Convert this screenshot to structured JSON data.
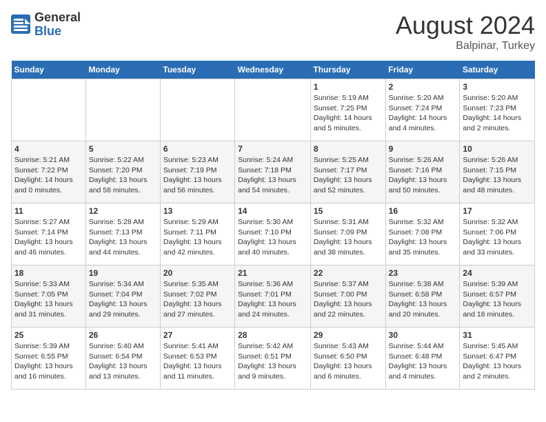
{
  "header": {
    "logo_general": "General",
    "logo_blue": "Blue",
    "month_year": "August 2024",
    "location": "Balpinar, Turkey"
  },
  "weekdays": [
    "Sunday",
    "Monday",
    "Tuesday",
    "Wednesday",
    "Thursday",
    "Friday",
    "Saturday"
  ],
  "weeks": [
    [
      {
        "day": "",
        "info": ""
      },
      {
        "day": "",
        "info": ""
      },
      {
        "day": "",
        "info": ""
      },
      {
        "day": "",
        "info": ""
      },
      {
        "day": "1",
        "info": "Sunrise: 5:19 AM\nSunset: 7:25 PM\nDaylight: 14 hours\nand 5 minutes."
      },
      {
        "day": "2",
        "info": "Sunrise: 5:20 AM\nSunset: 7:24 PM\nDaylight: 14 hours\nand 4 minutes."
      },
      {
        "day": "3",
        "info": "Sunrise: 5:20 AM\nSunset: 7:23 PM\nDaylight: 14 hours\nand 2 minutes."
      }
    ],
    [
      {
        "day": "4",
        "info": "Sunrise: 5:21 AM\nSunset: 7:22 PM\nDaylight: 14 hours\nand 0 minutes."
      },
      {
        "day": "5",
        "info": "Sunrise: 5:22 AM\nSunset: 7:20 PM\nDaylight: 13 hours\nand 58 minutes."
      },
      {
        "day": "6",
        "info": "Sunrise: 5:23 AM\nSunset: 7:19 PM\nDaylight: 13 hours\nand 56 minutes."
      },
      {
        "day": "7",
        "info": "Sunrise: 5:24 AM\nSunset: 7:18 PM\nDaylight: 13 hours\nand 54 minutes."
      },
      {
        "day": "8",
        "info": "Sunrise: 5:25 AM\nSunset: 7:17 PM\nDaylight: 13 hours\nand 52 minutes."
      },
      {
        "day": "9",
        "info": "Sunrise: 5:26 AM\nSunset: 7:16 PM\nDaylight: 13 hours\nand 50 minutes."
      },
      {
        "day": "10",
        "info": "Sunrise: 5:26 AM\nSunset: 7:15 PM\nDaylight: 13 hours\nand 48 minutes."
      }
    ],
    [
      {
        "day": "11",
        "info": "Sunrise: 5:27 AM\nSunset: 7:14 PM\nDaylight: 13 hours\nand 46 minutes."
      },
      {
        "day": "12",
        "info": "Sunrise: 5:28 AM\nSunset: 7:13 PM\nDaylight: 13 hours\nand 44 minutes."
      },
      {
        "day": "13",
        "info": "Sunrise: 5:29 AM\nSunset: 7:11 PM\nDaylight: 13 hours\nand 42 minutes."
      },
      {
        "day": "14",
        "info": "Sunrise: 5:30 AM\nSunset: 7:10 PM\nDaylight: 13 hours\nand 40 minutes."
      },
      {
        "day": "15",
        "info": "Sunrise: 5:31 AM\nSunset: 7:09 PM\nDaylight: 13 hours\nand 38 minutes."
      },
      {
        "day": "16",
        "info": "Sunrise: 5:32 AM\nSunset: 7:08 PM\nDaylight: 13 hours\nand 35 minutes."
      },
      {
        "day": "17",
        "info": "Sunrise: 5:32 AM\nSunset: 7:06 PM\nDaylight: 13 hours\nand 33 minutes."
      }
    ],
    [
      {
        "day": "18",
        "info": "Sunrise: 5:33 AM\nSunset: 7:05 PM\nDaylight: 13 hours\nand 31 minutes."
      },
      {
        "day": "19",
        "info": "Sunrise: 5:34 AM\nSunset: 7:04 PM\nDaylight: 13 hours\nand 29 minutes."
      },
      {
        "day": "20",
        "info": "Sunrise: 5:35 AM\nSunset: 7:02 PM\nDaylight: 13 hours\nand 27 minutes."
      },
      {
        "day": "21",
        "info": "Sunrise: 5:36 AM\nSunset: 7:01 PM\nDaylight: 13 hours\nand 24 minutes."
      },
      {
        "day": "22",
        "info": "Sunrise: 5:37 AM\nSunset: 7:00 PM\nDaylight: 13 hours\nand 22 minutes."
      },
      {
        "day": "23",
        "info": "Sunrise: 5:38 AM\nSunset: 6:58 PM\nDaylight: 13 hours\nand 20 minutes."
      },
      {
        "day": "24",
        "info": "Sunrise: 5:39 AM\nSunset: 6:57 PM\nDaylight: 13 hours\nand 18 minutes."
      }
    ],
    [
      {
        "day": "25",
        "info": "Sunrise: 5:39 AM\nSunset: 6:55 PM\nDaylight: 13 hours\nand 16 minutes."
      },
      {
        "day": "26",
        "info": "Sunrise: 5:40 AM\nSunset: 6:54 PM\nDaylight: 13 hours\nand 13 minutes."
      },
      {
        "day": "27",
        "info": "Sunrise: 5:41 AM\nSunset: 6:53 PM\nDaylight: 13 hours\nand 11 minutes."
      },
      {
        "day": "28",
        "info": "Sunrise: 5:42 AM\nSunset: 6:51 PM\nDaylight: 13 hours\nand 9 minutes."
      },
      {
        "day": "29",
        "info": "Sunrise: 5:43 AM\nSunset: 6:50 PM\nDaylight: 13 hours\nand 6 minutes."
      },
      {
        "day": "30",
        "info": "Sunrise: 5:44 AM\nSunset: 6:48 PM\nDaylight: 13 hours\nand 4 minutes."
      },
      {
        "day": "31",
        "info": "Sunrise: 5:45 AM\nSunset: 6:47 PM\nDaylight: 13 hours\nand 2 minutes."
      }
    ]
  ]
}
